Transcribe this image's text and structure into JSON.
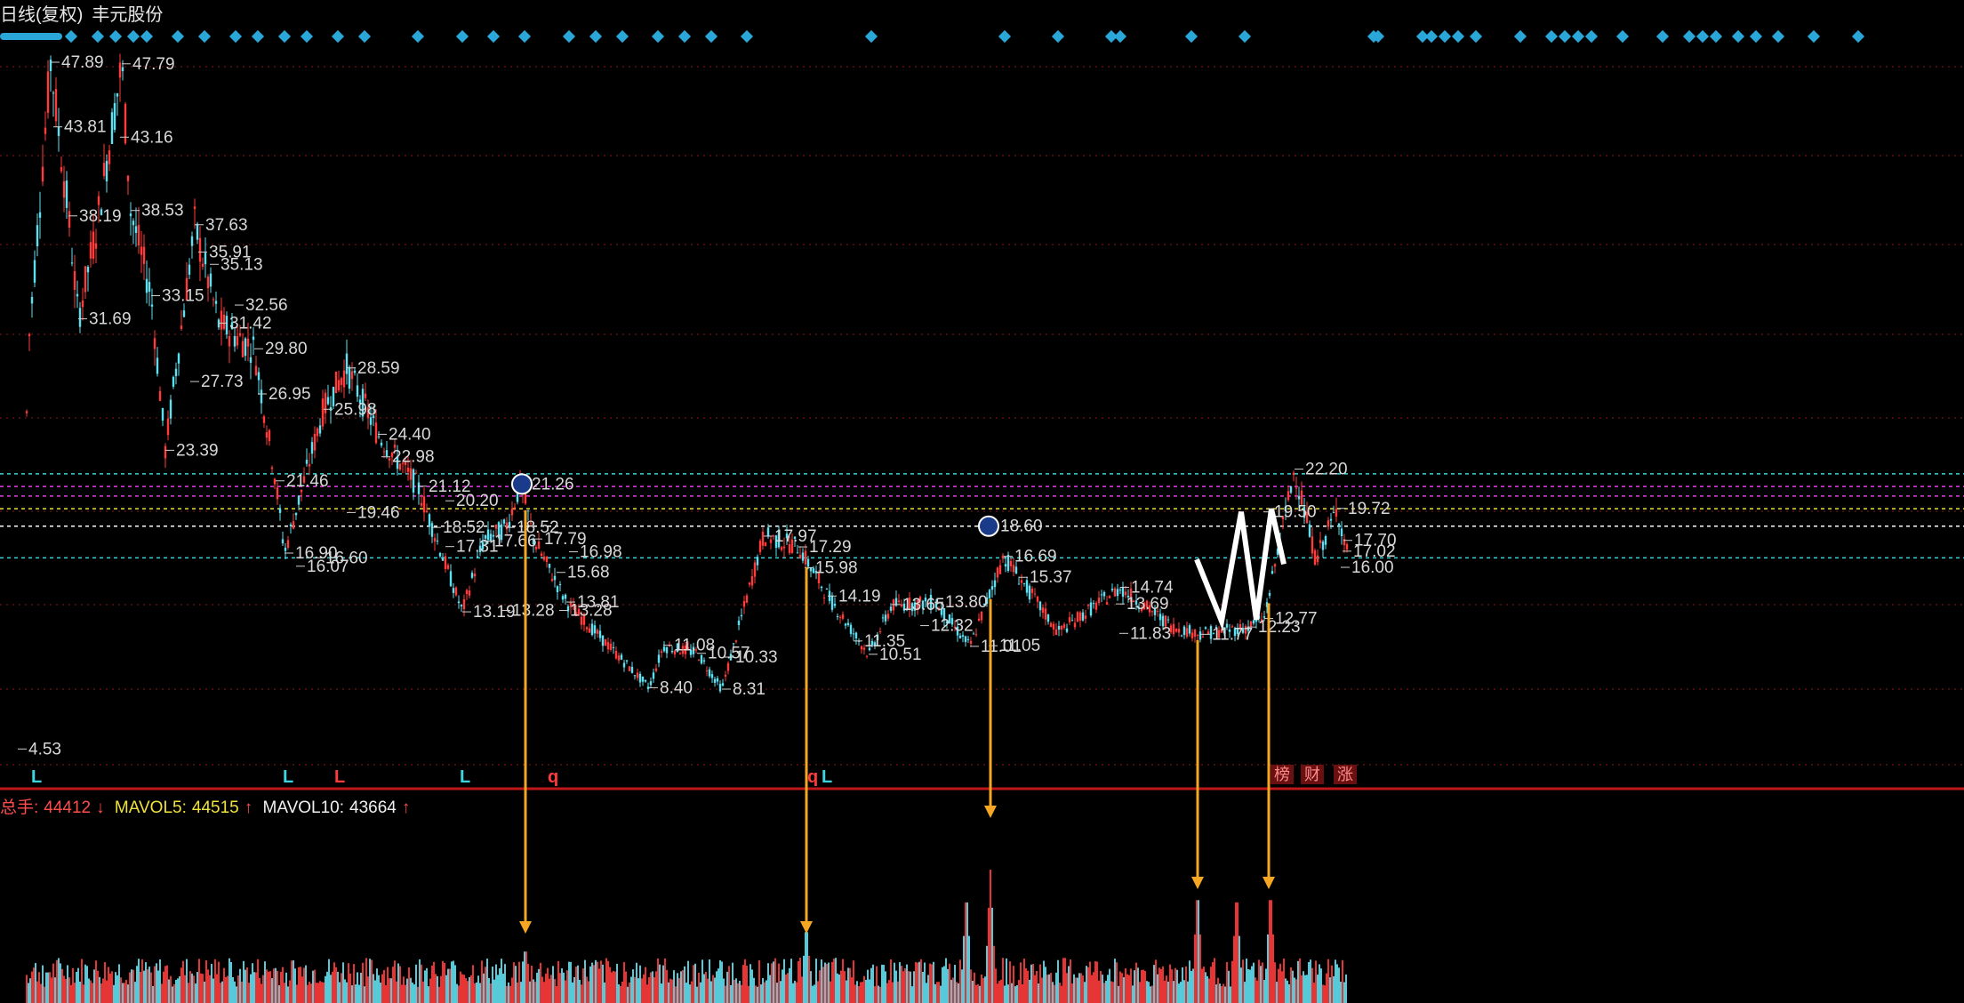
{
  "header": {
    "period": "日线(复权)",
    "stock_name": "丰元股份"
  },
  "volume_legend": {
    "total_label": "总手:",
    "total_value": "44412",
    "total_arrow": "↓",
    "ma5_label": "MAVOL5:",
    "ma5_value": "44515",
    "ma5_arrow": "↑",
    "ma10_label": "MAVOL10:",
    "ma10_value": "43664",
    "ma10_arrow": "↑"
  },
  "colors": {
    "background": "#000000",
    "up_candle": "#ff3b3b",
    "down_candle": "#5fe0f0",
    "grid": "#8b1a1a",
    "divider": "#c01818",
    "arrow": "#f5a623",
    "marker": "#2aa7d8",
    "line_cyan": "#3ad6e0",
    "line_magenta": "#e040e0",
    "line_yellow": "#e8e040",
    "line_white": "#ffffff"
  },
  "chart_data": {
    "type": "candlestick",
    "price_range": [
      4.0,
      52.0
    ],
    "horizontal_levels": [
      {
        "value": 21.9,
        "color": "cyan"
      },
      {
        "value": 21.1,
        "color": "magenta"
      },
      {
        "value": 20.5,
        "color": "magenta"
      },
      {
        "value": 19.7,
        "color": "yellow"
      },
      {
        "value": 18.6,
        "color": "white"
      },
      {
        "value": 16.6,
        "color": "cyan"
      }
    ],
    "price_labels": [
      {
        "bar": 37,
        "value": "47.89"
      },
      {
        "bar": 117,
        "value": "47.79"
      },
      {
        "bar": 40,
        "value": "43.81"
      },
      {
        "bar": 115,
        "value": "43.16"
      },
      {
        "bar": 57,
        "value": "38.19"
      },
      {
        "bar": 127,
        "value": "38.53"
      },
      {
        "bar": 199,
        "value": "37.63"
      },
      {
        "bar": 203,
        "value": "35.91"
      },
      {
        "bar": 216,
        "value": "35.13"
      },
      {
        "bar": 150,
        "value": "33.15"
      },
      {
        "bar": 244,
        "value": "32.56"
      },
      {
        "bar": 68,
        "value": "31.69"
      },
      {
        "bar": 226,
        "value": "31.42"
      },
      {
        "bar": 266,
        "value": "29.80"
      },
      {
        "bar": 370,
        "value": "28.59"
      },
      {
        "bar": 194,
        "value": "27.73"
      },
      {
        "bar": 270,
        "value": "26.95"
      },
      {
        "bar": 344,
        "value": "25.98"
      },
      {
        "bar": 405,
        "value": "24.40"
      },
      {
        "bar": 166,
        "value": "23.39"
      },
      {
        "bar": 409,
        "value": "22.98"
      },
      {
        "bar": 450,
        "value": "21.12"
      },
      {
        "bar": 290,
        "value": "21.46"
      },
      {
        "bar": 566,
        "value": "21.26"
      },
      {
        "bar": 481,
        "value": "20.20"
      },
      {
        "bar": 370,
        "value": "19.46"
      },
      {
        "bar": 466,
        "value": "18.52"
      },
      {
        "bar": 549,
        "value": "18.52"
      },
      {
        "bar": 839,
        "value": "17.97"
      },
      {
        "bar": 481,
        "value": "17.31"
      },
      {
        "bar": 524,
        "value": "17.66"
      },
      {
        "bar": 580,
        "value": "17.79"
      },
      {
        "bar": 878,
        "value": "17.29"
      },
      {
        "bar": 620,
        "value": "16.98"
      },
      {
        "bar": 300,
        "value": "16.90"
      },
      {
        "bar": 334,
        "value": "16.60"
      },
      {
        "bar": 313,
        "value": "16.07"
      },
      {
        "bar": 885,
        "value": "15.98"
      },
      {
        "bar": 606,
        "value": "15.68"
      },
      {
        "bar": 1109,
        "value": "16.69"
      },
      {
        "bar": 1126,
        "value": "15.37"
      },
      {
        "bar": 911,
        "value": "14.19"
      },
      {
        "bar": 1240,
        "value": "14.74"
      },
      {
        "bar": 617,
        "value": "13.81"
      },
      {
        "bar": 983,
        "value": "13.65"
      },
      {
        "bar": 1031,
        "value": "13.80"
      },
      {
        "bar": 1235,
        "value": "13.69"
      },
      {
        "bar": 500,
        "value": "13.19"
      },
      {
        "bar": 544,
        "value": "13.28"
      },
      {
        "bar": 609,
        "value": "13.28"
      },
      {
        "bar": 1015,
        "value": "12.32"
      },
      {
        "bar": 1402,
        "value": "12.77"
      },
      {
        "bar": 1383,
        "value": "12.23"
      },
      {
        "bar": 940,
        "value": "11.35"
      },
      {
        "bar": 1239,
        "value": "11.83"
      },
      {
        "bar": 1331,
        "value": "11.77"
      },
      {
        "bar": 726,
        "value": "11.08"
      },
      {
        "bar": 1071,
        "value": "11.01"
      },
      {
        "bar": 1092,
        "value": "11.05"
      },
      {
        "bar": 764,
        "value": "10.57"
      },
      {
        "bar": 957,
        "value": "10.51"
      },
      {
        "bar": 795,
        "value": "10.33"
      },
      {
        "bar": 710,
        "value": "8.40"
      },
      {
        "bar": 792,
        "value": "8.31"
      },
      {
        "bar": 1436,
        "value": "22.20"
      },
      {
        "bar": 1484,
        "value": "19.72"
      },
      {
        "bar": 1401,
        "value": "19.50"
      },
      {
        "bar": 1491,
        "value": "17.70"
      },
      {
        "bar": 1490,
        "value": "17.02"
      },
      {
        "bar": 1488,
        "value": "16.00"
      },
      {
        "bar": 1093,
        "value": "18.60"
      },
      {
        "bar": 0,
        "value": "4.53"
      }
    ],
    "circle_markers": [
      {
        "bar": 567,
        "value": 21.26
      },
      {
        "bar": 1092,
        "value": 18.6
      }
    ],
    "signal_letters": [
      {
        "bar": 15,
        "text": "L",
        "color": "cyan"
      },
      {
        "bar": 298,
        "text": "L",
        "color": "cyan"
      },
      {
        "bar": 356,
        "text": "L",
        "color": "red"
      },
      {
        "bar": 497,
        "text": "L",
        "color": "cyan"
      },
      {
        "bar": 596,
        "text": "q",
        "color": "red"
      },
      {
        "bar": 888,
        "text": "q",
        "color": "red"
      },
      {
        "bar": 904,
        "text": "L",
        "color": "cyan"
      }
    ],
    "badges": [
      {
        "bar": 1409,
        "text": "榜"
      },
      {
        "bar": 1443,
        "text": "财"
      },
      {
        "bar": 1480,
        "text": "涨"
      }
    ],
    "arrows_to_volume": [
      {
        "bar": 571
      },
      {
        "bar": 887
      },
      {
        "bar": 1094
      },
      {
        "bar": 1327
      },
      {
        "bar": 1407
      }
    ],
    "w_pattern": [
      {
        "bar": 1326,
        "value": 16.5
      },
      {
        "bar": 1354,
        "value": 12.6
      },
      {
        "bar": 1376,
        "value": 19.5
      },
      {
        "bar": 1393,
        "value": 12.7
      },
      {
        "bar": 1410,
        "value": 19.7
      },
      {
        "bar": 1424,
        "value": 16.2
      }
    ],
    "volume_spikes": [
      {
        "bar": 571,
        "rel": 0.45
      },
      {
        "bar": 887,
        "rel": 0.62
      },
      {
        "bar": 1067,
        "rel": 0.88
      },
      {
        "bar": 1094,
        "rel": 1.0
      },
      {
        "bar": 1327,
        "rel": 0.9
      },
      {
        "bar": 1371,
        "rel": 0.88
      },
      {
        "bar": 1409,
        "rel": 0.9
      }
    ]
  }
}
